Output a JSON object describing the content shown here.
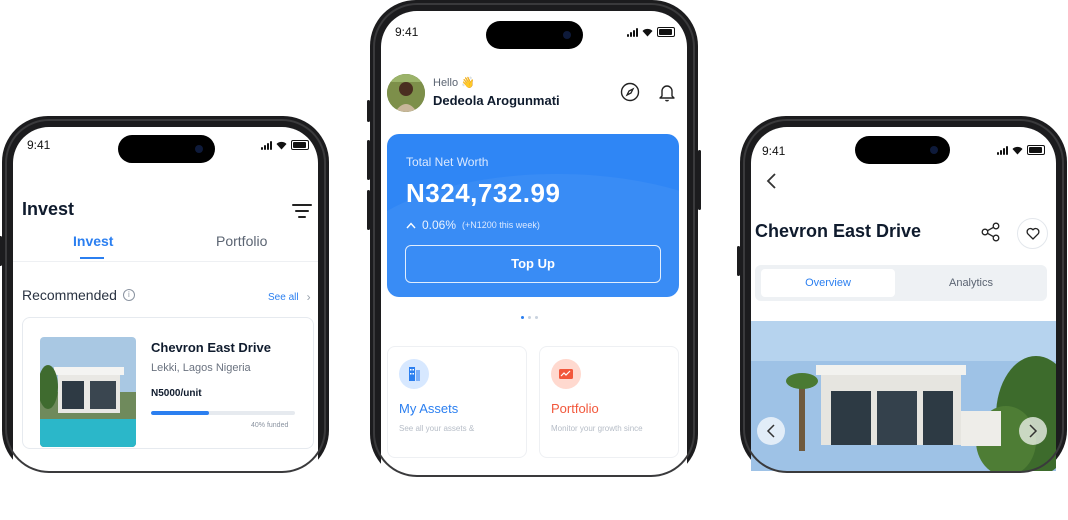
{
  "colors": {
    "accent": "#2b7ff0",
    "card": "#2f86f5",
    "portfolio": "#f2573b"
  },
  "invest_screen": {
    "status_time": "9:41",
    "title": "Invest",
    "tabs": [
      {
        "label": "Invest",
        "active": true
      },
      {
        "label": "Portfolio",
        "active": false
      }
    ],
    "section_title": "Recommended",
    "see_all": "See all",
    "card": {
      "title": "Chevron East Drive",
      "location": "Lekki, Lagos Nigeria",
      "price": "N5000/unit",
      "funded_fraction": 0.4,
      "funded_label": "40% funded"
    }
  },
  "home_screen": {
    "status_time": "9:41",
    "greeting": "Hello 👋",
    "user_name": "Dedeola Arogunmati",
    "net_worth_label": "Total Net Worth",
    "net_worth_value": "N324,732.99",
    "change_percent": "0.06%",
    "change_note": "(+N1200 this week)",
    "top_up_label": "Top Up",
    "carousel_active_index": 0,
    "tiles": [
      {
        "title": "My Assets",
        "desc": "See all your assets &",
        "icon": "building-icon"
      },
      {
        "title": "Portfolio",
        "desc": "Monitor your growth since",
        "icon": "chart-icon"
      }
    ]
  },
  "detail_screen": {
    "status_time": "9:41",
    "title": "Chevron East Drive",
    "segments": [
      {
        "label": "Overview",
        "active": true
      },
      {
        "label": "Analytics",
        "active": false
      }
    ]
  }
}
